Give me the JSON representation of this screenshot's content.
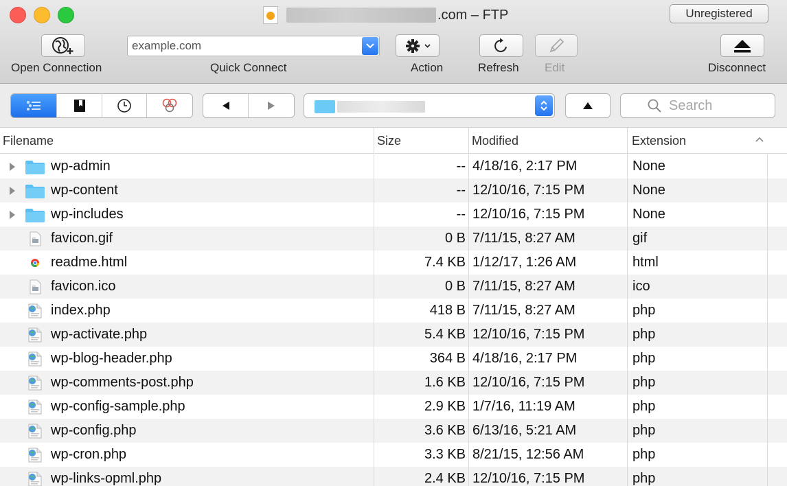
{
  "window": {
    "title_suffix": ".com – FTP",
    "unregistered_label": "Unregistered"
  },
  "toolbar": {
    "open_connection_label": "Open Connection",
    "quick_connect_value": "example.com",
    "quick_connect_label": "Quick Connect",
    "action_label": "Action",
    "refresh_label": "Refresh",
    "edit_label": "Edit",
    "disconnect_label": "Disconnect"
  },
  "browser": {
    "search_placeholder": "Search"
  },
  "columns": {
    "filename": "Filename",
    "size": "Size",
    "modified": "Modified",
    "extension": "Extension"
  },
  "files": [
    {
      "name": "wp-admin",
      "size": "--",
      "modified": "4/18/16, 2:17 PM",
      "ext": "None",
      "type": "folder"
    },
    {
      "name": "wp-content",
      "size": "--",
      "modified": "12/10/16, 7:15 PM",
      "ext": "None",
      "type": "folder"
    },
    {
      "name": "wp-includes",
      "size": "--",
      "modified": "12/10/16, 7:15 PM",
      "ext": "None",
      "type": "folder"
    },
    {
      "name": "favicon.gif",
      "size": "0 B",
      "modified": "7/11/15, 8:27 AM",
      "ext": "gif",
      "type": "image"
    },
    {
      "name": "readme.html",
      "size": "7.4 KB",
      "modified": "1/12/17, 1:26 AM",
      "ext": "html",
      "type": "html"
    },
    {
      "name": "favicon.ico",
      "size": "0 B",
      "modified": "7/11/15, 8:27 AM",
      "ext": "ico",
      "type": "image"
    },
    {
      "name": "index.php",
      "size": "418 B",
      "modified": "7/11/15, 8:27 AM",
      "ext": "php",
      "type": "php"
    },
    {
      "name": "wp-activate.php",
      "size": "5.4 KB",
      "modified": "12/10/16, 7:15 PM",
      "ext": "php",
      "type": "php"
    },
    {
      "name": "wp-blog-header.php",
      "size": "364 B",
      "modified": "4/18/16, 2:17 PM",
      "ext": "php",
      "type": "php"
    },
    {
      "name": "wp-comments-post.php",
      "size": "1.6 KB",
      "modified": "12/10/16, 7:15 PM",
      "ext": "php",
      "type": "php"
    },
    {
      "name": "wp-config-sample.php",
      "size": "2.9 KB",
      "modified": "1/7/16, 11:19 AM",
      "ext": "php",
      "type": "php"
    },
    {
      "name": "wp-config.php",
      "size": "3.6 KB",
      "modified": "6/13/16, 5:21 AM",
      "ext": "php",
      "type": "php"
    },
    {
      "name": "wp-cron.php",
      "size": "3.3 KB",
      "modified": "8/21/15, 12:56 AM",
      "ext": "php",
      "type": "php"
    },
    {
      "name": "wp-links-opml.php",
      "size": "2.4 KB",
      "modified": "12/10/16, 7:15 PM",
      "ext": "php",
      "type": "php"
    }
  ]
}
